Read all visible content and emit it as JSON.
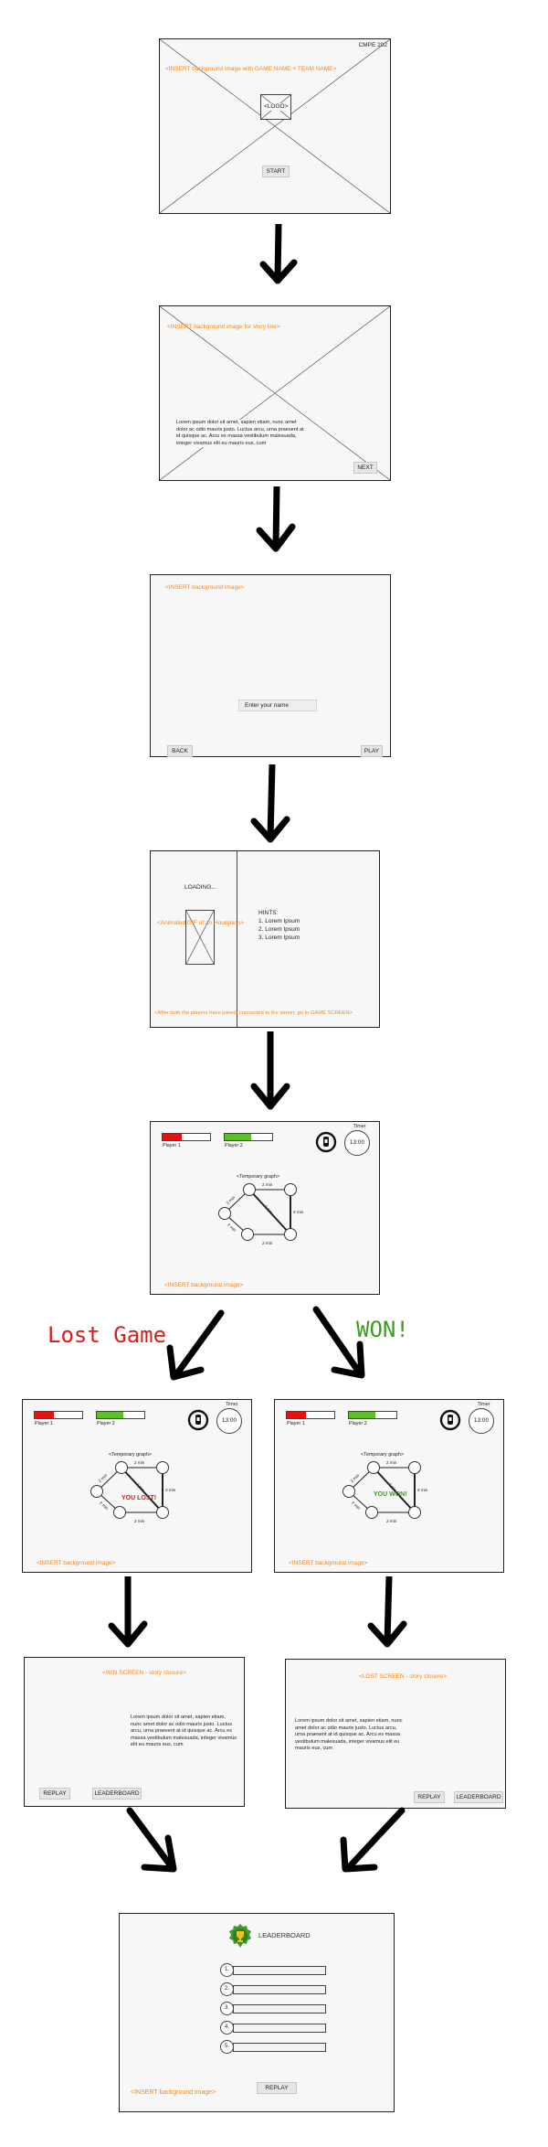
{
  "colors": {
    "orange": "#f08a1c",
    "red": "#d61f1f",
    "green": "#3a9e1e",
    "bar_red": "#e31313",
    "bar_green": "#5cbf2a"
  },
  "s1": {
    "corner": "CMPE 202",
    "bg_note": "<INSERT background image with GAME NAME + TEAM NAME>",
    "logo": "<LOGO>",
    "start": "START"
  },
  "s2": {
    "bg_note": "<INSERT background image for story line>",
    "story": "Lorem ipsum dolor sit amet, sapien etiam, nunc amet dolor ac odio mauris justo. Luctus arcu, urna praesent at id quisque ac. Arcu es massa vestibulum malesuada, integer vivamus elit eu mauris eus, cum",
    "next": "NEXT"
  },
  "s3": {
    "bg_note": "<INSERT background image>",
    "name_placeholder": "Enter your name",
    "back": "BACK",
    "play": "PLAY"
  },
  "s4": {
    "loading": "LOADING...",
    "anim": "<Animated GIF of an Hourglass>",
    "hints_title": "HINTS:",
    "hints": [
      "1. Lorem Ipsum",
      "2. Lorem Ipsum",
      "3. Lorem Ipsum"
    ],
    "bottom": "<After both the players have joined/ connected to the server, go to GAME SCREEN>"
  },
  "game": {
    "player1": "Player 1",
    "player2": "Player 2",
    "timer_label": "Timer",
    "timer": "13:00",
    "graph_label": "<Temporary graph>",
    "edges": [
      "2 min",
      "3 min",
      "2 min",
      "2 min",
      "2 min",
      "2 min",
      "2 min"
    ],
    "bg_note": "<INSERT background image>",
    "p1_fill": 0.4,
    "p2_fill": 0.55
  },
  "branch": {
    "lost": "Lost Game",
    "won": "WON!"
  },
  "lost_game": {
    "overlay": "YOU LOST!"
  },
  "won_game": {
    "overlay": "YOU WON!"
  },
  "win_screen": {
    "title": "<WIN SCREEN - story closure>",
    "story": "Lorem ipsum dolor sit amet, sapien etiam, nunc amet dolor ac odio mauris justo. Luctus arcu, urna praesent at id quisque ac. Arcu es massa vestibulum malesuada, integer vivamus elit eu mauris eus, cum",
    "replay": "REPLAY",
    "leaderboard": "LEADERBOARD"
  },
  "lost_screen": {
    "title": "<LOST SCREEN - story closure>",
    "story": "Lorem ipsum dolor sit amet, sapien etiam, nunc amet dolor ac odio mauris justo. Luctus arcu, urna praesent at id quisque ac. Arcu es massa vestibulum malesuada, integer vivamus elit eu mauris eus, cum",
    "replay": "REPLAY",
    "leaderboard": "LEADERBOARD"
  },
  "leaderboard": {
    "title": "LEADERBOARD",
    "ranks": [
      "1.",
      "2.",
      "3.",
      "4.",
      "5."
    ],
    "bg_note": "<INSERT background image>",
    "replay": "REPLAY"
  }
}
